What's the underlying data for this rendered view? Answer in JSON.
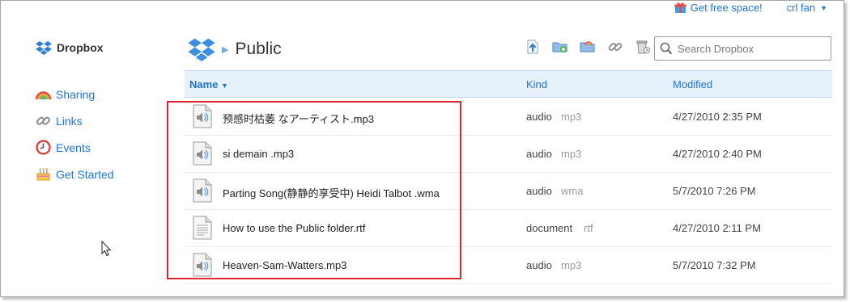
{
  "topbar": {
    "free_space_label": "Get free space!",
    "user_label": "crl fan"
  },
  "sidebar": {
    "brand": "Dropbox",
    "items": [
      {
        "label": "Sharing",
        "icon": "rainbow-icon"
      },
      {
        "label": "Links",
        "icon": "link-icon"
      },
      {
        "label": "Events",
        "icon": "clock-icon"
      },
      {
        "label": "Get Started",
        "icon": "cake-icon"
      }
    ]
  },
  "header": {
    "folder_title": "Public",
    "toolbar_icons": [
      "upload-icon",
      "new-folder-icon",
      "share-folder-icon",
      "get-link-icon",
      "show-deleted-icon"
    ]
  },
  "search": {
    "placeholder": "Search Dropbox"
  },
  "table": {
    "columns": {
      "name": "Name",
      "kind": "Kind",
      "modified": "Modified"
    },
    "rows": [
      {
        "name": "预感时枯萎 なアーティスト.mp3",
        "kind": "audio",
        "ext": "mp3",
        "modified": "4/27/2010 2:35 PM",
        "icon": "audio-file-icon"
      },
      {
        "name": "si demain .mp3",
        "kind": "audio",
        "ext": "mp3",
        "modified": "4/27/2010 2:40 PM",
        "icon": "audio-file-icon"
      },
      {
        "name": "Parting Song(静静的享受中) Heidi Talbot .wma",
        "kind": "audio",
        "ext": "wma",
        "modified": "5/7/2010 7:26 PM",
        "icon": "audio-file-icon"
      },
      {
        "name": "How to use the Public folder.rtf",
        "kind": "document",
        "ext": "rtf",
        "modified": "4/27/2010 2:11 PM",
        "icon": "document-file-icon"
      },
      {
        "name": "Heaven-Sam-Watters.mp3",
        "kind": "audio",
        "ext": "mp3",
        "modified": "5/7/2010 7:32 PM",
        "icon": "audio-file-icon"
      }
    ]
  },
  "colors": {
    "accent": "#1f75cc",
    "header_bg": "#e6f1fb",
    "highlight": "#e0252f"
  }
}
